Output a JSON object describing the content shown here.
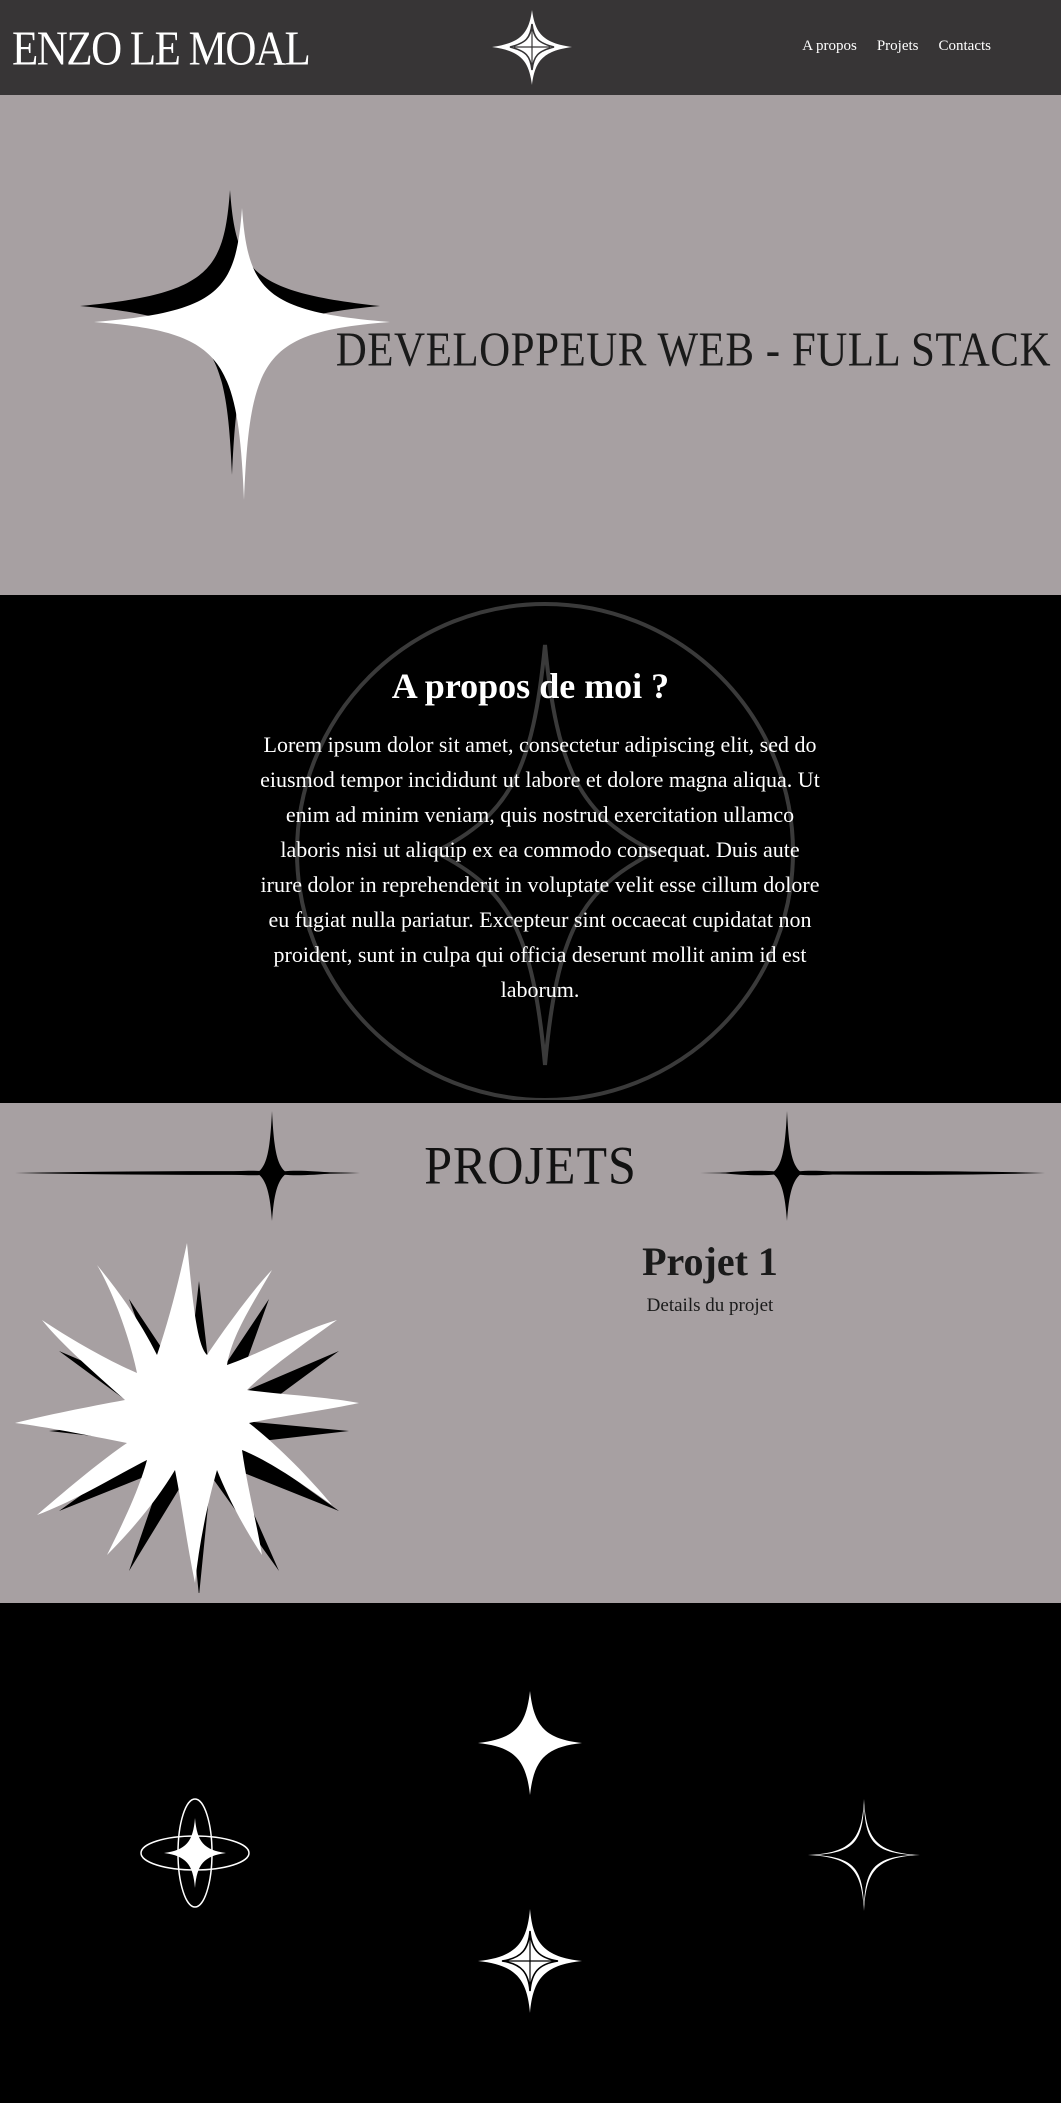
{
  "header": {
    "brand": "ENZO LE MOAL",
    "nav": [
      "A propos",
      "Projets",
      "Contacts"
    ]
  },
  "hero": {
    "title": "DEVELOPPEUR WEB - FULL STACK"
  },
  "about": {
    "title": "A propos de moi ?",
    "text": "Lorem ipsum dolor sit amet, consectetur adipiscing elit, sed do eiusmod tempor incididunt ut labore et dolore magna aliqua. Ut enim ad minim veniam, quis nostrud exercitation ullamco laboris nisi ut aliquip ex ea commodo consequat. Duis aute irure dolor in reprehenderit in voluptate velit esse cillum dolore eu fugiat nulla pariatur. Excepteur sint occaecat cupidatat non proident, sunt in culpa qui officia deserunt mollit anim id est laborum."
  },
  "projects": {
    "title": "PROJETS",
    "items": [
      {
        "name": "Projet 1",
        "details": "Details du projet"
      }
    ]
  },
  "colors": {
    "header_bg": "#373536",
    "section_grey": "#a7a0a2",
    "section_black": "#000000",
    "text_light": "#ffffff",
    "text_dark": "#1a1a1a"
  }
}
